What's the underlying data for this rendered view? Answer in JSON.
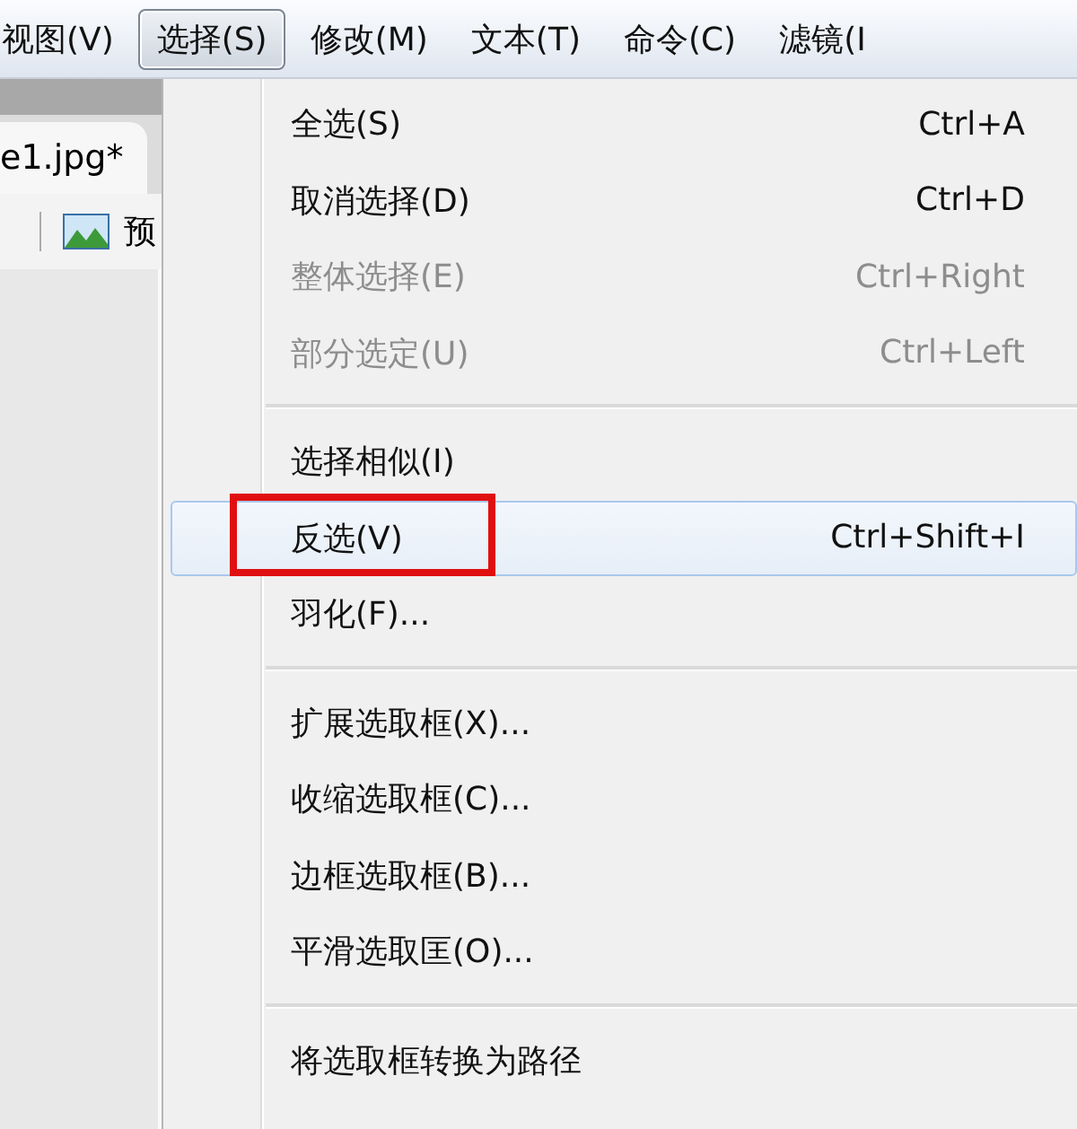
{
  "menu_bar": [
    {
      "label": "视图(V)",
      "selected": false
    },
    {
      "label": "选择(S)",
      "selected": true
    },
    {
      "label": "修改(M)",
      "selected": false
    },
    {
      "label": "文本(T)",
      "selected": false
    },
    {
      "label": "命令(C)",
      "selected": false
    },
    {
      "label": "滤镜(I",
      "selected": false
    }
  ],
  "document_tab": {
    "label": "e1.jpg*"
  },
  "toolbar": {
    "preview_label": "预"
  },
  "menu": [
    {
      "kind": "item",
      "label": "全选(S)",
      "shortcut": "Ctrl+A",
      "disabled": false,
      "selected": false,
      "annotated": false
    },
    {
      "kind": "item",
      "label": "取消选择(D)",
      "shortcut": "Ctrl+D",
      "disabled": false,
      "selected": false,
      "annotated": false
    },
    {
      "kind": "item",
      "label": "整体选择(E)",
      "shortcut": "Ctrl+Right",
      "disabled": true,
      "selected": false,
      "annotated": false
    },
    {
      "kind": "item",
      "label": "部分选定(U)",
      "shortcut": "Ctrl+Left",
      "disabled": true,
      "selected": false,
      "annotated": false
    },
    {
      "kind": "separator"
    },
    {
      "kind": "item",
      "label": "选择相似(I)",
      "disabled": false,
      "selected": false,
      "annotated": false
    },
    {
      "kind": "item",
      "label": "反选(V)",
      "shortcut": "Ctrl+Shift+I",
      "disabled": false,
      "selected": true,
      "annotated": true
    },
    {
      "kind": "item",
      "label": "羽化(F)...",
      "disabled": false,
      "selected": false,
      "annotated": false
    },
    {
      "kind": "separator"
    },
    {
      "kind": "item",
      "label": "扩展选取框(X)...",
      "disabled": false,
      "selected": false,
      "annotated": false
    },
    {
      "kind": "item",
      "label": "收缩选取框(C)...",
      "disabled": false,
      "selected": false,
      "annotated": false
    },
    {
      "kind": "item",
      "label": "边框选取框(B)...",
      "disabled": false,
      "selected": false,
      "annotated": false
    },
    {
      "kind": "item",
      "label": "平滑选取匡(O)...",
      "disabled": false,
      "selected": false,
      "annotated": false
    },
    {
      "kind": "separator"
    },
    {
      "kind": "item",
      "label": "将选取框转换为路径",
      "disabled": false,
      "selected": false,
      "annotated": false
    }
  ]
}
